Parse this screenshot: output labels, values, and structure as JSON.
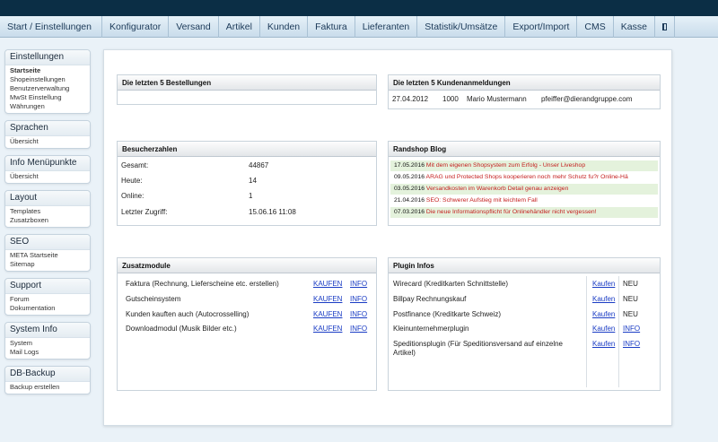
{
  "nav": {
    "items": [
      "Start / Einstellungen",
      "Konfigurator",
      "Versand",
      "Artikel",
      "Kunden",
      "Faktura",
      "Lieferanten",
      "Statistik/Umsätze",
      "Export/Import",
      "CMS",
      "Kasse"
    ],
    "icon": "calculator-icon"
  },
  "sidebar": [
    {
      "title": "Einstellungen",
      "links": [
        "Startseite",
        "Shopeinstellungen",
        "Benutzerverwaltung",
        "MwSt Einstellung",
        "Währungen"
      ],
      "active": 0
    },
    {
      "title": "Sprachen",
      "links": [
        "Übersicht"
      ]
    },
    {
      "title": "Info Menüpunkte",
      "links": [
        "Übersicht"
      ]
    },
    {
      "title": "Layout",
      "links": [
        "Templates",
        "Zusatzboxen"
      ]
    },
    {
      "title": "SEO",
      "links": [
        "META Startseite",
        "Sitemap"
      ]
    },
    {
      "title": "Support",
      "links": [
        "Forum",
        "Dokumentation"
      ]
    },
    {
      "title": "System Info",
      "links": [
        "System",
        "Mail Logs"
      ]
    },
    {
      "title": "DB-Backup",
      "links": [
        "Backup erstellen"
      ]
    }
  ],
  "orders": {
    "title": "Die letzten 5 Bestellungen"
  },
  "customers": {
    "title": "Die letzten 5 Kundenanmeldungen",
    "rows": [
      {
        "date": "27.04.2012",
        "id": "1000",
        "name": "Mario Mustermann",
        "email": "pfeiffer@dierandgruppe.com"
      }
    ]
  },
  "visitors": {
    "title": "Besucherzahlen",
    "rows": [
      {
        "label": "Gesamt:",
        "value": "44867"
      },
      {
        "label": "Heute:",
        "value": "14"
      },
      {
        "label": "Online:",
        "value": "1"
      },
      {
        "label": "Letzter Zugriff:",
        "value": "15.06.16 11:08"
      }
    ]
  },
  "blog": {
    "title": "Randshop Blog",
    "rows": [
      {
        "date": "17.05.2016",
        "text": "Mit dem eigenen Shopsystem zum Erfolg - Unser Liveshop",
        "hl": true,
        "red": true
      },
      {
        "date": "09.05.2016",
        "text": "ARAG und Protected Shops kooperieren  noch mehr Schutz fu?r Online-Hä",
        "hl": false,
        "red": true
      },
      {
        "date": "03.05.2016",
        "text": "Versandkosten im Warenkorb Detail genau anzeigen",
        "hl": true,
        "red": true
      },
      {
        "date": "21.04.2016",
        "text": "SEO: Schwerer Aufstieg mit leichtem Fall",
        "hl": false,
        "red": true
      },
      {
        "date": "07.03.2016",
        "text": "Die neue Informationspflicht für Onlinehändler nicht vergessen!",
        "hl": true,
        "red": true
      }
    ]
  },
  "modules": {
    "title": "Zusatzmodule",
    "buy_label": "KAUFEN",
    "info_label": "INFO",
    "rows": [
      "Faktura (Rechnung, Lieferscheine etc. erstellen)",
      "Gutscheinsystem",
      "Kunden kauften auch (Autocrosselling)",
      "Downloadmodul (Musik Bilder etc.)"
    ]
  },
  "plugins": {
    "title": "Plugin Infos",
    "buy_label": "Kaufen",
    "new_label": "NEU",
    "info_label": "INFO",
    "rows": [
      {
        "name": "Wirecard (Kreditkarten Schnittstelle)",
        "status": "NEU"
      },
      {
        "name": "Billpay Rechnungskauf",
        "status": "NEU"
      },
      {
        "name": "Postfinance (Kreditkarte Schweiz)",
        "status": "NEU"
      },
      {
        "name": "Kleinunternehmerplugin",
        "status": "INFO"
      },
      {
        "name": "Speditionsplugin (Für Speditionsversand auf einzelne Artikel)",
        "status": "INFO"
      }
    ]
  }
}
